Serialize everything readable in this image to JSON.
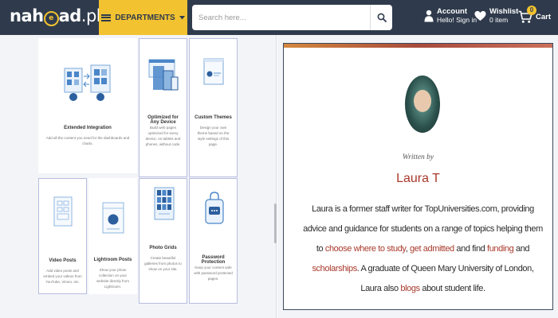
{
  "header": {
    "logo_pre": "nah",
    "logo_mark": "e",
    "logo_post": "ad",
    "logo_tld": ".pk",
    "departments_label": "DEPARTMENTS",
    "search_placeholder": "Search here...",
    "account_title": "Account",
    "account_sub": "Hello! Sign in",
    "wishlist_title": "Wishlist",
    "wishlist_sub": "0 item",
    "cart_label": "Cart",
    "cart_count": "0",
    "colors": {
      "navy": "#2f3b4c",
      "yellow": "#f2c230",
      "accent": "#a83a2c"
    }
  },
  "features": [
    {
      "title": "Extended Integration",
      "desc": "Add all the content you need for the dashboards and charts."
    },
    {
      "title": "Optimized for Any Device",
      "desc": "Build web pages optimized for every device, on tablets and phones, without code."
    },
    {
      "title": "Custom Themes",
      "desc": "Design your own theme based on the style settings of this page."
    },
    {
      "title": "Video Posts",
      "desc": "Add video posts and embed your videos from YouTube, Vimeo, etc."
    },
    {
      "title": "Lightroom Posts",
      "desc": "Show your photo collection on your website directly from Lightroom."
    },
    {
      "title": "Photo Grids",
      "desc": "Create beautiful galleries from photos to show on your site."
    },
    {
      "title": "Password Protection",
      "desc": "Keep your content safe with password protected pages."
    }
  ],
  "author": {
    "written_by": "Written by",
    "name": "Laura T",
    "bio_1": "Laura is a former staff writer for TopUniversities.com, providing advice and guidance for students on a range of topics helping them to ",
    "link_1": "choose where to study",
    "bio_2": ", ",
    "link_2": "get admitted",
    "bio_3": " and find ",
    "link_3": "funding",
    "bio_4": " and ",
    "link_4": "scholarships",
    "bio_5": ". A graduate of Queen Mary University of London, Laura also ",
    "link_5": "blogs",
    "bio_6": " about student life."
  }
}
